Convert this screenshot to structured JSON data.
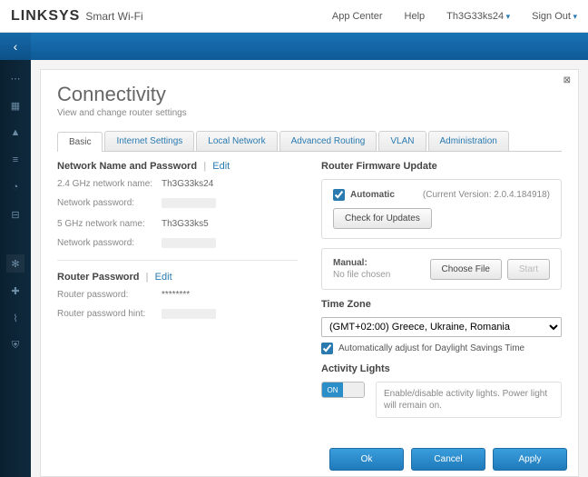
{
  "header": {
    "brand": "LINKSYS",
    "product": "Smart Wi-Fi",
    "links": {
      "app_center": "App Center",
      "help": "Help",
      "user": "Th3G33ks24",
      "signout": "Sign Out"
    }
  },
  "page": {
    "title": "Connectivity",
    "subtitle": "View and change router settings"
  },
  "tabs": [
    "Basic",
    "Internet Settings",
    "Local Network",
    "Advanced Routing",
    "VLAN",
    "Administration"
  ],
  "network": {
    "section": "Network Name and Password",
    "edit": "Edit",
    "rows": {
      "n24_label": "2.4 GHz network name:",
      "n24_value": "Th3G33ks24",
      "p24_label": "Network password:",
      "n5_label": "5 GHz network name:",
      "n5_value": "Th3G33ks5",
      "p5_label": "Network password:"
    }
  },
  "routerpw": {
    "section": "Router Password",
    "edit": "Edit",
    "pw_label": "Router password:",
    "pw_value": "********",
    "hint_label": "Router password hint:"
  },
  "firmware": {
    "section": "Router Firmware Update",
    "auto_label": "Automatic",
    "version_text": "(Current Version: 2.0.4.184918)",
    "check_btn": "Check for Updates",
    "manual_label": "Manual:",
    "nofile": "No file chosen",
    "choose_btn": "Choose File",
    "start_btn": "Start"
  },
  "timezone": {
    "section": "Time Zone",
    "selected": "(GMT+02:00) Greece, Ukraine, Romania",
    "dst_label": "Automatically adjust for Daylight Savings Time"
  },
  "activity": {
    "section": "Activity Lights",
    "on": "ON",
    "note": "Enable/disable activity lights. Power light will remain on."
  },
  "footer": {
    "ok": "Ok",
    "cancel": "Cancel",
    "apply": "Apply"
  }
}
